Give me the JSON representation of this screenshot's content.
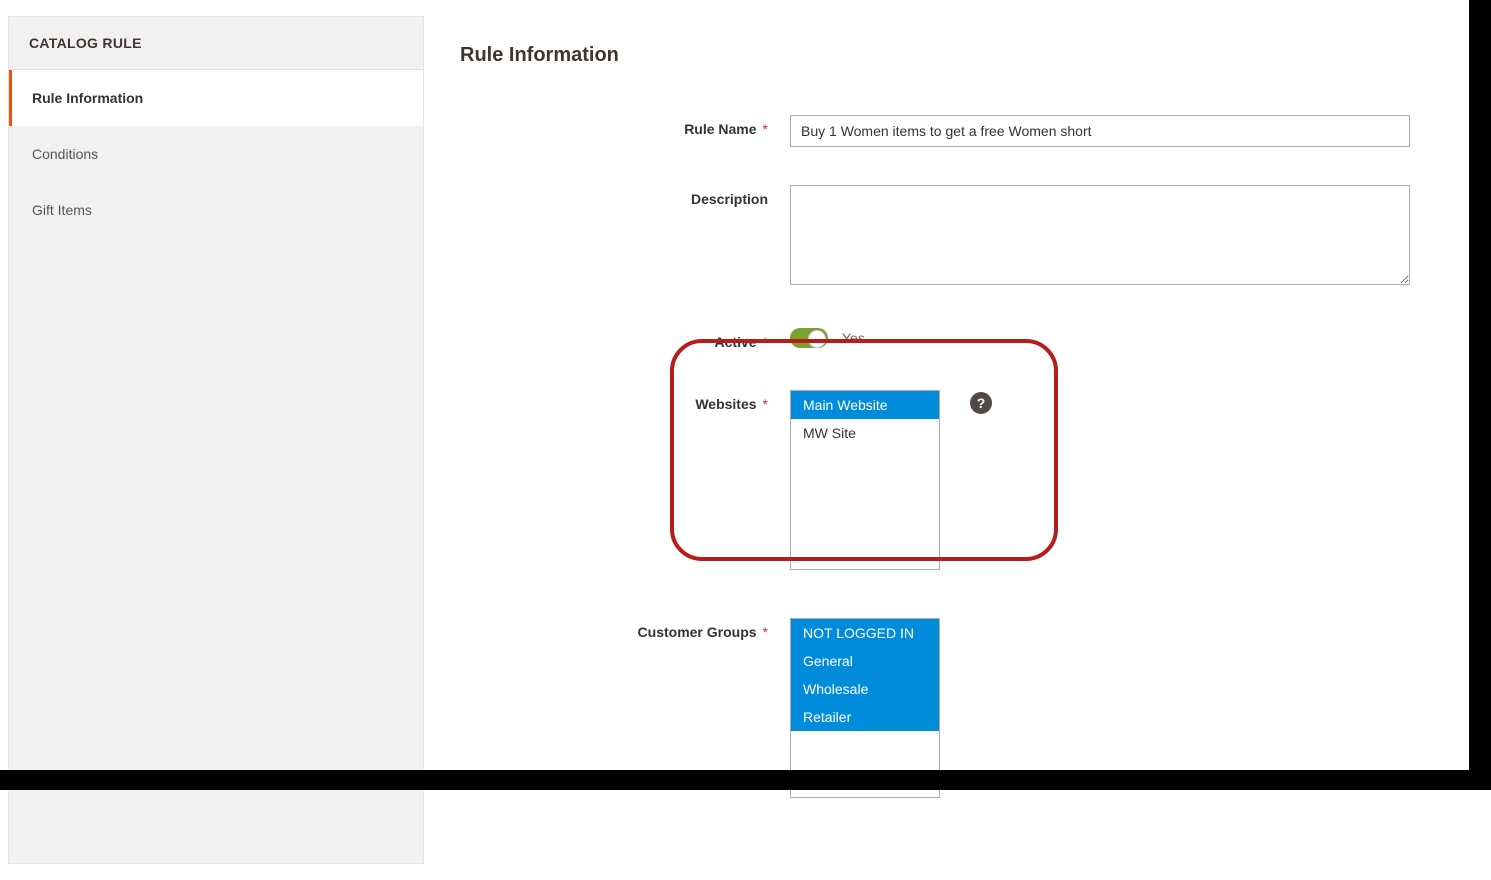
{
  "sidebar": {
    "header": "CATALOG RULE",
    "items": [
      {
        "label": "Rule Information",
        "active": true
      },
      {
        "label": "Conditions",
        "active": false
      },
      {
        "label": "Gift Items",
        "active": false
      }
    ]
  },
  "title": "Rule Information",
  "fields": {
    "rule_name": {
      "label": "Rule Name",
      "value": "Buy 1 Women items to get a free Women short"
    },
    "description": {
      "label": "Description",
      "value": ""
    },
    "active": {
      "label": "Active",
      "text": "Yes"
    },
    "websites": {
      "label": "Websites",
      "options": [
        {
          "label": "Main Website",
          "selected": true
        },
        {
          "label": "MW Site",
          "selected": false
        }
      ]
    },
    "customer_groups": {
      "label": "Customer Groups",
      "options": [
        {
          "label": "NOT LOGGED IN",
          "selected": true
        },
        {
          "label": "General",
          "selected": true
        },
        {
          "label": "Wholesale",
          "selected": true
        },
        {
          "label": "Retailer",
          "selected": true
        }
      ]
    }
  },
  "help_icon": "?"
}
